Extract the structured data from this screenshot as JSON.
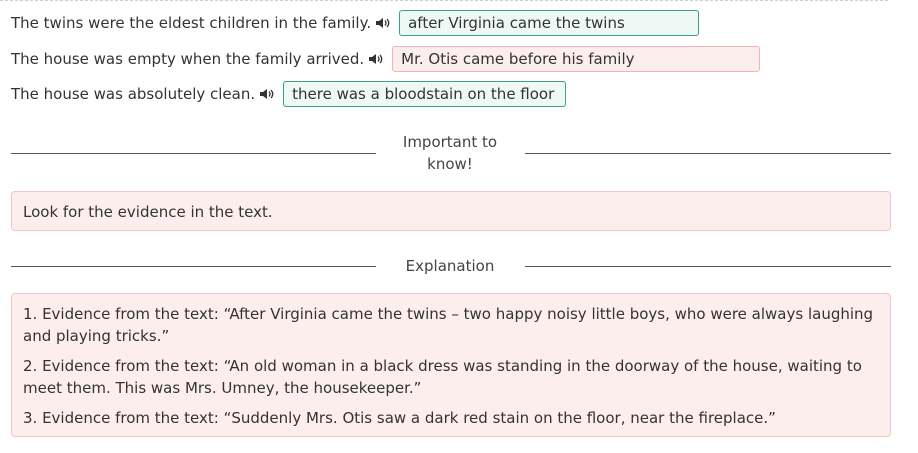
{
  "rows": [
    {
      "sentence": "The twins were the eldest children in the family.",
      "answer": "after Virginia came the twins",
      "status": "correct"
    },
    {
      "sentence": "The house was empty when the family arrived.",
      "answer": "Mr. Otis came before his family",
      "status": "wrong"
    },
    {
      "sentence": "The house was absolutely clean.",
      "answer": "there was a bloodstain on the floor",
      "status": "correct"
    }
  ],
  "important": {
    "title_line1": "Important to",
    "title_line2": "know!",
    "text": "Look for the evidence in the text."
  },
  "explanation": {
    "title": "Explanation",
    "items": [
      "1. Evidence from the text: “After Virginia came the twins – two happy noisy little boys, who were always laughing and playing tricks.”",
      "2. Evidence from the text: “An old woman in a black dress was standing in the doorway of the house, waiting to meet them. This was Mrs. Umney, the housekeeper.”",
      "3. Evidence from the text: “Suddenly Mrs. Otis saw a dark red stain on the floor, near the fireplace.”"
    ]
  },
  "colors": {
    "correct_border": "#3aa189",
    "correct_bg": "#eef8f4",
    "wrong_border": "#f0b6b6",
    "wrong_bg": "#fdeeee"
  },
  "icons": {
    "speaker": "speaker-icon"
  }
}
